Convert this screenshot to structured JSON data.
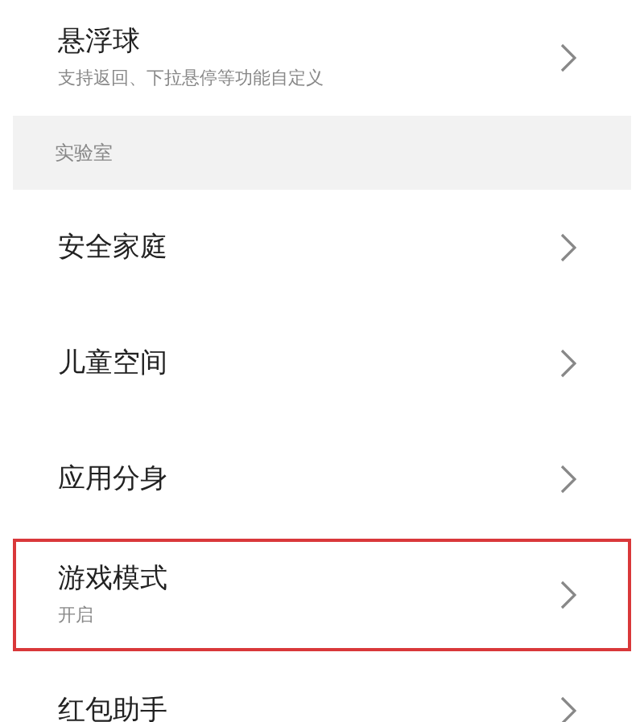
{
  "items": [
    {
      "kind": "row",
      "title": "悬浮球",
      "subtitle": "支持返回、下拉悬停等功能自定义",
      "highlighted": false
    },
    {
      "kind": "header",
      "title": "实验室"
    },
    {
      "kind": "row",
      "title": "安全家庭",
      "highlighted": false
    },
    {
      "kind": "row",
      "title": "儿童空间",
      "highlighted": false
    },
    {
      "kind": "row",
      "title": "应用分身",
      "highlighted": false
    },
    {
      "kind": "row",
      "title": "游戏模式",
      "subtitle": "开启",
      "highlighted": true
    },
    {
      "kind": "row",
      "title": "红包助手",
      "highlighted": false
    }
  ]
}
